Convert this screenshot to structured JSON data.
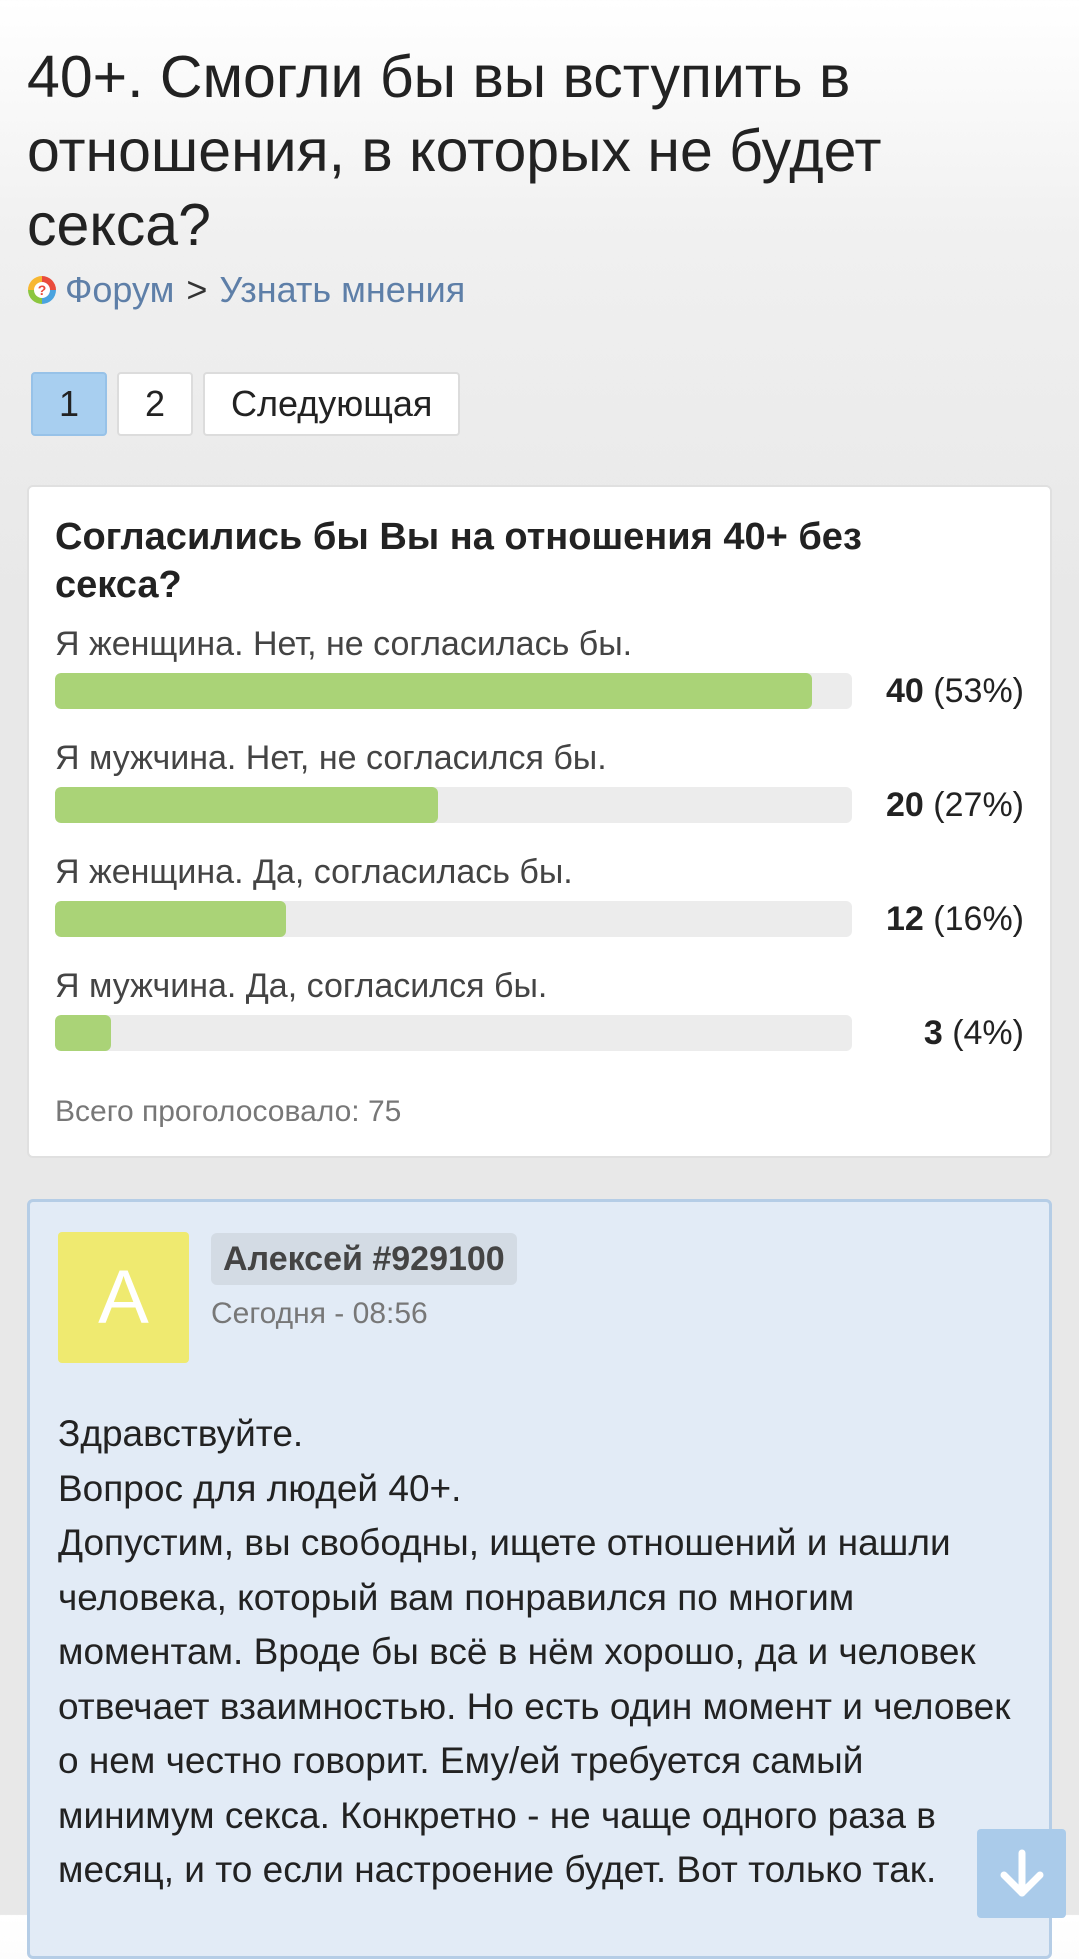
{
  "page": {
    "title": "40+. Смогли бы вы вступить в отношения, в которых не будет секса?"
  },
  "breadcrumb": {
    "forum": "Форум",
    "separator": ">",
    "section": "Узнать мнения"
  },
  "pagination": {
    "pages": [
      "1",
      "2"
    ],
    "active": "1",
    "next_label": "Следующая"
  },
  "poll": {
    "question": "Согласились бы Вы на отношения 40+ без секса?",
    "options": [
      {
        "label": "Я женщина. Нет, не согласилась бы.",
        "votes": "40",
        "percent_text": "(53%)",
        "fill": 0.95
      },
      {
        "label": "Я мужчина. Нет, не согласился бы.",
        "votes": "20",
        "percent_text": "(27%)",
        "fill": 0.48
      },
      {
        "label": "Я женщина. Да, согласилась бы.",
        "votes": "12",
        "percent_text": "(16%)",
        "fill": 0.29
      },
      {
        "label": "Я мужчина. Да, согласился бы.",
        "votes": "3",
        "percent_text": "(4%)",
        "fill": 0.07
      }
    ],
    "total": "Всего проголосовало: 75",
    "colors": {
      "bar": "#aad377",
      "track": "#ececec"
    }
  },
  "post": {
    "avatar_letter": "А",
    "author": "Алексей #929100",
    "time": "Сегодня - 08:56",
    "body": "Здравствуйте.\nВопрос для людей 40+.\nДопустим, вы свободны, ищете отношений и нашли человека, который вам понравился по многим моментам. Вроде бы всё в нём хорошо, да и человек отвечает взаимностью. Но есть один момент и человек о нем честно говорит. Ему/ей требуется самый минимум секса. Конкретно - не чаще одного раза в месяц, и то если настроение будет. Вот только так."
  },
  "scroll_button": {
    "icon": "arrow-down-icon"
  }
}
